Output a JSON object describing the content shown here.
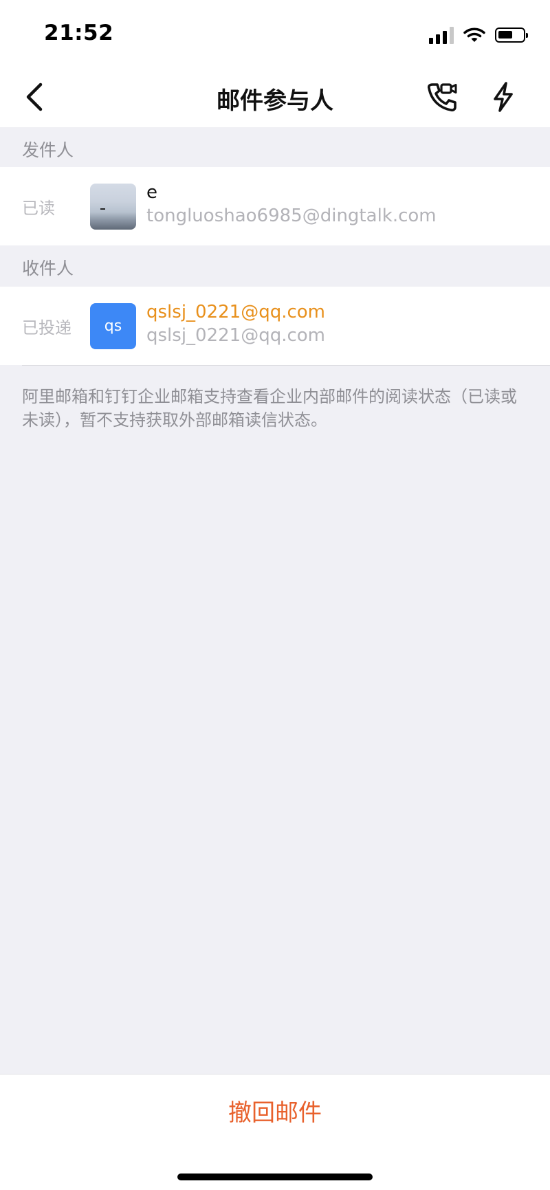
{
  "status_bar": {
    "time": "21:52"
  },
  "nav": {
    "title": "邮件参与人",
    "icons": [
      "back-arrow-icon",
      "video-call-icon",
      "flash-icon"
    ]
  },
  "sender_section": {
    "header": "发件人",
    "row": {
      "status": "已读",
      "name": "e",
      "email": "tongluoshao6985@dingtalk.com",
      "avatar": "photo"
    }
  },
  "recipient_section": {
    "header": "收件人",
    "row": {
      "status": "已投递",
      "avatar_text": "qs",
      "name": "qslsj_0221@qq.com",
      "email": "qslsj_0221@qq.com"
    }
  },
  "note": {
    "text": "阿里邮箱和钉钉企业邮箱支持查看企业内部邮件的阅读状态（已读或未读），暂不支持获取外部邮箱读信状态。"
  },
  "footer": {
    "recall_label": "撤回邮件"
  },
  "colors": {
    "accent_orange": "#e8901c",
    "recall_red": "#e8612c",
    "avatar_blue": "#3d88f6",
    "background": "#f0f0f5"
  }
}
